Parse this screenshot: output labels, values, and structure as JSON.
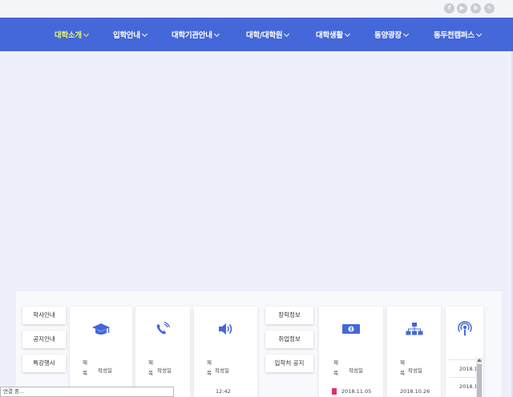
{
  "social": [
    "f",
    "▶",
    "b",
    "✎"
  ],
  "nav": {
    "items": [
      {
        "label": "대학소개",
        "active": true
      },
      {
        "label": "입학안내"
      },
      {
        "label": "대학기관안내"
      },
      {
        "label": "대학/대학원"
      },
      {
        "label": "대학생활"
      },
      {
        "label": "동양광장"
      },
      {
        "label": "동두천캠퍼스"
      }
    ]
  },
  "tabs_left": [
    "학사안내",
    "공지안내",
    "특강행사"
  ],
  "tabs_mid": [
    "장학정보",
    "취업정보",
    "입학처 공지"
  ],
  "columns": {
    "je_mok": "제\n목",
    "date": "작성일"
  },
  "values": {
    "time": "12:42",
    "date1": "2018.11.05",
    "date2": "2018.10.26",
    "date3": "2018.1",
    "date4": "2018.1"
  },
  "status_text": "연결 중...",
  "colors": {
    "nav_bg": "#4468d9",
    "accent_icon": "#4468d9",
    "active_nav": "#e5f27a"
  }
}
